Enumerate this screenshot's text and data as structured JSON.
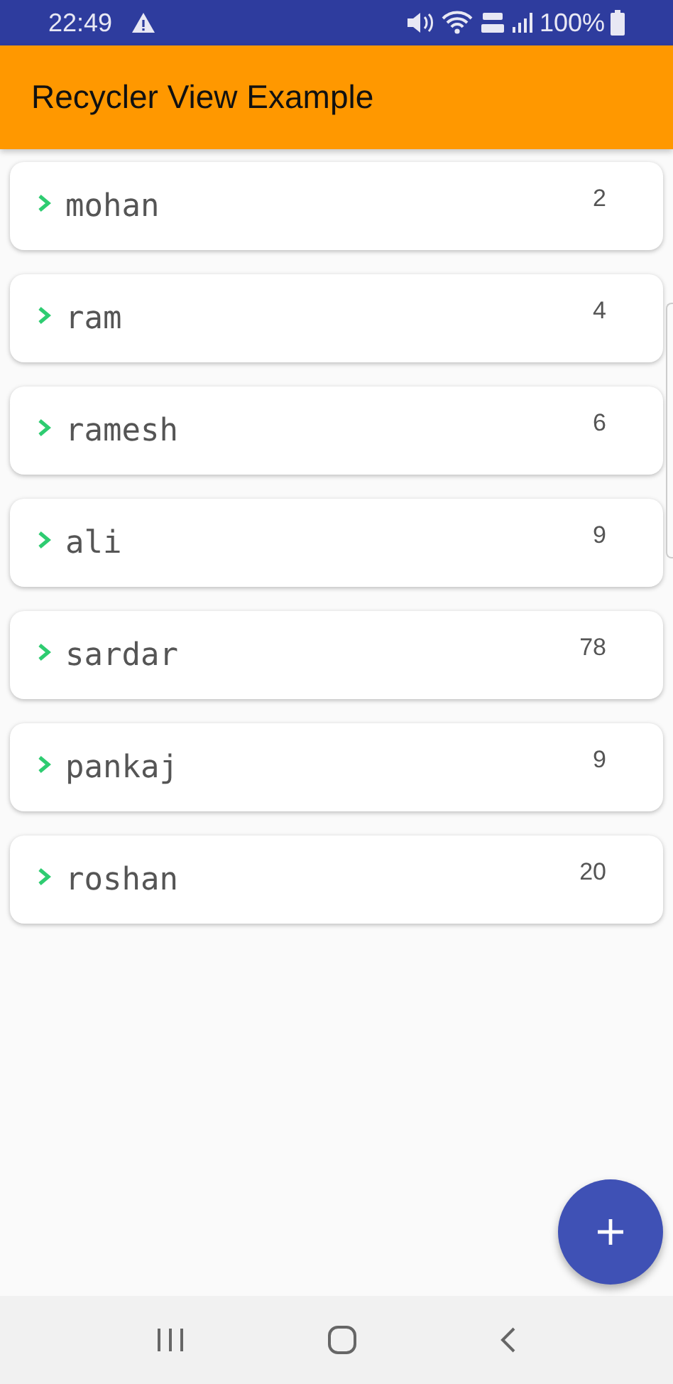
{
  "status_bar": {
    "time": "22:49",
    "battery": "100%"
  },
  "app_bar": {
    "title": "Recycler View Example"
  },
  "items": [
    {
      "name": "mohan",
      "count": "2"
    },
    {
      "name": "ram",
      "count": "4"
    },
    {
      "name": "ramesh",
      "count": "6"
    },
    {
      "name": "ali",
      "count": "9"
    },
    {
      "name": "sardar",
      "count": "78"
    },
    {
      "name": "pankaj",
      "count": "9"
    },
    {
      "name": "roshan",
      "count": "20"
    }
  ]
}
